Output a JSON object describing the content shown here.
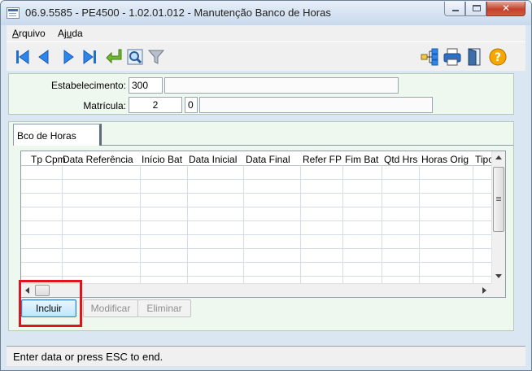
{
  "window": {
    "title": "06.9.5585 - PE4500 - 1.02.01.012 - Manutenção Banco de Horas"
  },
  "menu": {
    "arquivo_first": "A",
    "arquivo_rest": "rquivo",
    "ajuda_first": "Aj",
    "ajuda_mn": "u",
    "ajuda_rest": "da"
  },
  "toolbar": {
    "icons": [
      "first-record-icon",
      "previous-record-icon",
      "next-record-icon",
      "last-record-icon",
      "goto-icon",
      "search-icon",
      "filter-icon",
      "related-programs-icon",
      "print-icon",
      "exit-icon",
      "help-icon"
    ]
  },
  "form": {
    "estabelecimento_label": "Estabelecimento:",
    "estabelecimento_value": "300",
    "estabelecimento_desc": "",
    "matricula_label": "Matrícula:",
    "matricula_value": "2",
    "matricula_digit": "0",
    "matricula_name": ""
  },
  "tabs": [
    {
      "label": "Bco de Horas"
    }
  ],
  "grid": {
    "columns": [
      "Tp Cpm",
      "Data Referência",
      "Início Bat",
      "Data Inicial",
      "Data Final",
      "Refer FP",
      "Fim Bat",
      "Qtd Hrs",
      "Horas Orig",
      "Tipo"
    ],
    "rows": []
  },
  "buttons": {
    "incluir": "Incluir",
    "modificar": "Modificar",
    "eliminar": "Eliminar"
  },
  "status": {
    "text": "Enter data or press ESC to end."
  },
  "colors": {
    "highlight": "#e0141c",
    "form_background": "#eff8ee",
    "toolbar_icon_blue": "#1f6fd1"
  }
}
